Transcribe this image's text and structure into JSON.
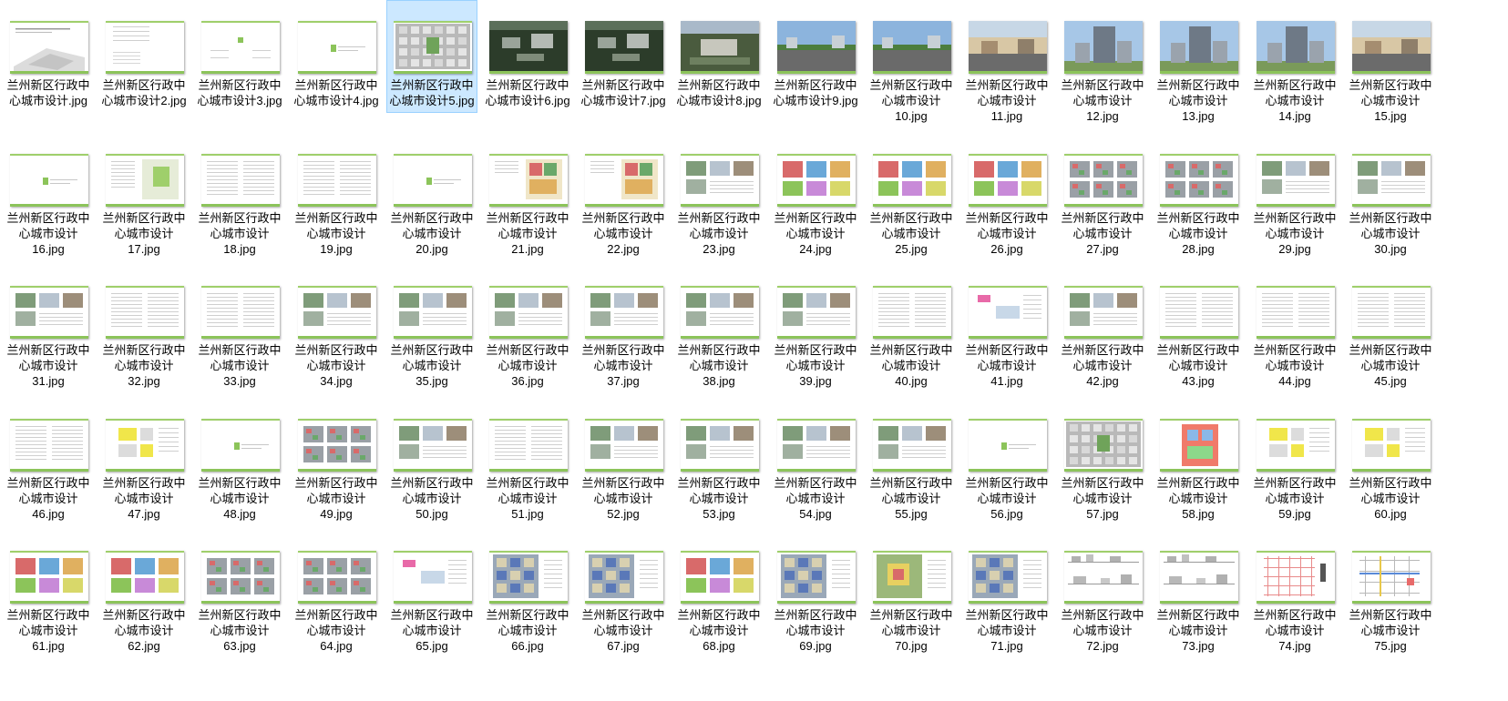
{
  "window": {
    "view": "large-icons",
    "selected_index": 4
  },
  "colors": {
    "selection_bg": "#cce8ff",
    "selection_border": "#99d1ff",
    "doc_accent": "#8cc45a",
    "caption_text": "#000000"
  },
  "files": [
    {
      "name": "兰州新区行政中\n心城市设计.jpg",
      "thumb": "cover"
    },
    {
      "name": "兰州新区行政中\n心城市设计2.jpg",
      "thumb": "toc"
    },
    {
      "name": "兰州新区行政中\n心城市设计3.jpg",
      "thumb": "toc2"
    },
    {
      "name": "兰州新区行政中\n心城市设计4.jpg",
      "thumb": "section"
    },
    {
      "name": "兰州新区行政中\n心城市设计5.jpg",
      "thumb": "masterplan"
    },
    {
      "name": "兰州新区行政中\n心城市设计6.jpg",
      "thumb": "aerial"
    },
    {
      "name": "兰州新区行政中\n心城市设计7.jpg",
      "thumb": "aerial"
    },
    {
      "name": "兰州新区行政中\n心城市设计8.jpg",
      "thumb": "aerial2"
    },
    {
      "name": "兰州新区行政中\n心城市设计9.jpg",
      "thumb": "street"
    },
    {
      "name": "兰州新区行政中\n心城市设计\n10.jpg",
      "thumb": "street"
    },
    {
      "name": "兰州新区行政中\n心城市设计\n11.jpg",
      "thumb": "sunset"
    },
    {
      "name": "兰州新区行政中\n心城市设计\n12.jpg",
      "thumb": "tower"
    },
    {
      "name": "兰州新区行政中\n心城市设计\n13.jpg",
      "thumb": "tower"
    },
    {
      "name": "兰州新区行政中\n心城市设计\n14.jpg",
      "thumb": "tower"
    },
    {
      "name": "兰州新区行政中\n心城市设计\n15.jpg",
      "thumb": "sunset"
    },
    {
      "name": "兰州新区行政中\n心城市设计\n16.jpg",
      "thumb": "section"
    },
    {
      "name": "兰州新区行政中\n心城市设计\n17.jpg",
      "thumb": "textmap"
    },
    {
      "name": "兰州新区行政中\n心城市设计\n18.jpg",
      "thumb": "text"
    },
    {
      "name": "兰州新区行政中\n心城市设计\n19.jpg",
      "thumb": "text"
    },
    {
      "name": "兰州新区行政中\n心城市设计\n20.jpg",
      "thumb": "section"
    },
    {
      "name": "兰州新区行政中\n心城市设计\n21.jpg",
      "thumb": "colormap"
    },
    {
      "name": "兰州新区行政中\n心城市设计\n22.jpg",
      "thumb": "colormap"
    },
    {
      "name": "兰州新区行政中\n心城市设计\n23.jpg",
      "thumb": "photos"
    },
    {
      "name": "兰州新区行政中\n心城市设计\n24.jpg",
      "thumb": "colorblocks"
    },
    {
      "name": "兰州新区行政中\n心城市设计\n25.jpg",
      "thumb": "colorblocks"
    },
    {
      "name": "兰州新区行政中\n心城市设计\n26.jpg",
      "thumb": "colorblocks"
    },
    {
      "name": "兰州新区行政中\n心城市设计\n27.jpg",
      "thumb": "grids"
    },
    {
      "name": "兰州新区行政中\n心城市设计\n28.jpg",
      "thumb": "grids"
    },
    {
      "name": "兰州新区行政中\n心城市设计\n29.jpg",
      "thumb": "photos"
    },
    {
      "name": "兰州新区行政中\n心城市设计\n30.jpg",
      "thumb": "photos"
    },
    {
      "name": "兰州新区行政中\n心城市设计\n31.jpg",
      "thumb": "photos"
    },
    {
      "name": "兰州新区行政中\n心城市设计\n32.jpg",
      "thumb": "text"
    },
    {
      "name": "兰州新区行政中\n心城市设计\n33.jpg",
      "thumb": "text"
    },
    {
      "name": "兰州新区行政中\n心城市设计\n34.jpg",
      "thumb": "photos"
    },
    {
      "name": "兰州新区行政中\n心城市设计\n35.jpg",
      "thumb": "photos"
    },
    {
      "name": "兰州新区行政中\n心城市设计\n36.jpg",
      "thumb": "photos"
    },
    {
      "name": "兰州新区行政中\n心城市设计\n37.jpg",
      "thumb": "photos"
    },
    {
      "name": "兰州新区行政中\n心城市设计\n38.jpg",
      "thumb": "photos"
    },
    {
      "name": "兰州新区行政中\n心城市设计\n39.jpg",
      "thumb": "photos"
    },
    {
      "name": "兰州新区行政中\n心城市设计\n40.jpg",
      "thumb": "text"
    },
    {
      "name": "兰州新区行政中\n心城市设计\n41.jpg",
      "thumb": "diagram"
    },
    {
      "name": "兰州新区行政中\n心城市设计\n42.jpg",
      "thumb": "photos"
    },
    {
      "name": "兰州新区行政中\n心城市设计\n43.jpg",
      "thumb": "text"
    },
    {
      "name": "兰州新区行政中\n心城市设计\n44.jpg",
      "thumb": "text"
    },
    {
      "name": "兰州新区行政中\n心城市设计\n45.jpg",
      "thumb": "text"
    },
    {
      "name": "兰州新区行政中\n心城市设计\n46.jpg",
      "thumb": "text"
    },
    {
      "name": "兰州新区行政中\n心城市设计\n47.jpg",
      "thumb": "yellowplan"
    },
    {
      "name": "兰州新区行政中\n心城市设计\n48.jpg",
      "thumb": "section"
    },
    {
      "name": "兰州新区行政中\n心城市设计\n49.jpg",
      "thumb": "grids"
    },
    {
      "name": "兰州新区行政中\n心城市设计\n50.jpg",
      "thumb": "photos"
    },
    {
      "name": "兰州新区行政中\n心城市设计\n51.jpg",
      "thumb": "text"
    },
    {
      "name": "兰州新区行政中\n心城市设计\n52.jpg",
      "thumb": "photos"
    },
    {
      "name": "兰州新区行政中\n心城市设计\n53.jpg",
      "thumb": "photos"
    },
    {
      "name": "兰州新区行政中\n心城市设计\n54.jpg",
      "thumb": "photos"
    },
    {
      "name": "兰州新区行政中\n心城市设计\n55.jpg",
      "thumb": "photos"
    },
    {
      "name": "兰州新区行政中\n心城市设计\n56.jpg",
      "thumb": "section"
    },
    {
      "name": "兰州新区行政中\n心城市设计\n57.jpg",
      "thumb": "masterplan"
    },
    {
      "name": "兰州新区行政中\n心城市设计\n58.jpg",
      "thumb": "redplan"
    },
    {
      "name": "兰州新区行政中\n心城市设计\n59.jpg",
      "thumb": "yellowplan"
    },
    {
      "name": "兰州新区行政中\n心城市设计\n60.jpg",
      "thumb": "yellowplan"
    },
    {
      "name": "兰州新区行政中\n心城市设计\n61.jpg",
      "thumb": "colorblocks"
    },
    {
      "name": "兰州新区行政中\n心城市设计\n62.jpg",
      "thumb": "colorblocks"
    },
    {
      "name": "兰州新区行政中\n心城市设计\n63.jpg",
      "thumb": "grids"
    },
    {
      "name": "兰州新区行政中\n心城市设计\n64.jpg",
      "thumb": "grids"
    },
    {
      "name": "兰州新区行政中\n心城市设计\n65.jpg",
      "thumb": "diagram"
    },
    {
      "name": "兰州新区行政中\n心城市设计\n66.jpg",
      "thumb": "blueplan"
    },
    {
      "name": "兰州新区行政中\n心城市设计\n67.jpg",
      "thumb": "blueplan"
    },
    {
      "name": "兰州新区行政中\n心城市设计\n68.jpg",
      "thumb": "colorblocks"
    },
    {
      "name": "兰州新区行政中\n心城市设计\n69.jpg",
      "thumb": "blueplan"
    },
    {
      "name": "兰州新区行政中\n心城市设计\n70.jpg",
      "thumb": "greenplan"
    },
    {
      "name": "兰州新区行政中\n心城市设计\n71.jpg",
      "thumb": "blueplan"
    },
    {
      "name": "兰州新区行政中\n心城市设计\n72.jpg",
      "thumb": "elevation"
    },
    {
      "name": "兰州新区行政中\n心城市设计\n73.jpg",
      "thumb": "elevation"
    },
    {
      "name": "兰州新区行政中\n心城市设计\n74.jpg",
      "thumb": "redgrid"
    },
    {
      "name": "兰州新区行政中\n心城市设计\n75.jpg",
      "thumb": "bluegrid"
    }
  ]
}
